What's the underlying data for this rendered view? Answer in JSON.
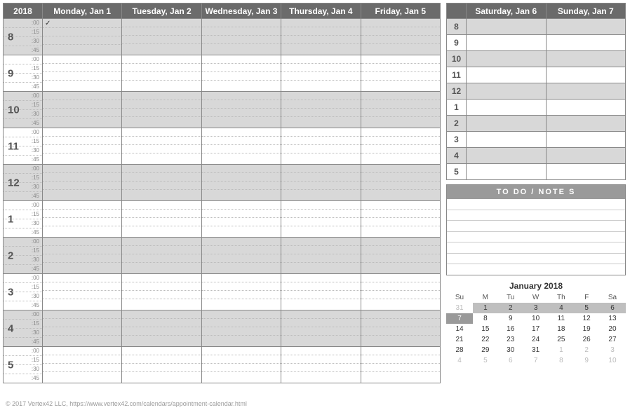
{
  "year": "2018",
  "weekdays": [
    "Monday, Jan 1",
    "Tuesday, Jan 2",
    "Wednesday, Jan 3",
    "Thursday, Jan 4",
    "Friday, Jan 5"
  ],
  "weekend": [
    "Saturday, Jan 6",
    "Sunday, Jan 7"
  ],
  "hours": [
    "8",
    "9",
    "10",
    "11",
    "12",
    "1",
    "2",
    "3",
    "4",
    "5"
  ],
  "subdivisions": [
    ":00",
    ":15",
    ":30",
    ":45"
  ],
  "weekend_hours": [
    "8",
    "9",
    "10",
    "11",
    "12",
    "1",
    "2",
    "3",
    "4",
    "5"
  ],
  "checkmark": "✓",
  "todo_header": "TO DO  /  NOTE S",
  "mini": {
    "title": "January 2018",
    "dow": [
      "Su",
      "M",
      "Tu",
      "W",
      "Th",
      "F",
      "Sa"
    ],
    "rows": [
      [
        {
          "d": "31",
          "cls": "prev"
        },
        {
          "d": "1",
          "cls": "hl"
        },
        {
          "d": "2",
          "cls": "hl"
        },
        {
          "d": "3",
          "cls": "hl"
        },
        {
          "d": "4",
          "cls": "hl"
        },
        {
          "d": "5",
          "cls": "hl"
        },
        {
          "d": "6",
          "cls": "hl"
        }
      ],
      [
        {
          "d": "7",
          "cls": "hl-dark"
        },
        {
          "d": "8",
          "cls": ""
        },
        {
          "d": "9",
          "cls": ""
        },
        {
          "d": "10",
          "cls": ""
        },
        {
          "d": "11",
          "cls": ""
        },
        {
          "d": "12",
          "cls": ""
        },
        {
          "d": "13",
          "cls": ""
        }
      ],
      [
        {
          "d": "14",
          "cls": ""
        },
        {
          "d": "15",
          "cls": ""
        },
        {
          "d": "16",
          "cls": ""
        },
        {
          "d": "17",
          "cls": ""
        },
        {
          "d": "18",
          "cls": ""
        },
        {
          "d": "19",
          "cls": ""
        },
        {
          "d": "20",
          "cls": ""
        }
      ],
      [
        {
          "d": "21",
          "cls": ""
        },
        {
          "d": "22",
          "cls": ""
        },
        {
          "d": "23",
          "cls": ""
        },
        {
          "d": "24",
          "cls": ""
        },
        {
          "d": "25",
          "cls": ""
        },
        {
          "d": "26",
          "cls": ""
        },
        {
          "d": "27",
          "cls": ""
        }
      ],
      [
        {
          "d": "28",
          "cls": ""
        },
        {
          "d": "29",
          "cls": ""
        },
        {
          "d": "30",
          "cls": ""
        },
        {
          "d": "31",
          "cls": ""
        },
        {
          "d": "1",
          "cls": "next"
        },
        {
          "d": "2",
          "cls": "next"
        },
        {
          "d": "3",
          "cls": "next"
        }
      ],
      [
        {
          "d": "4",
          "cls": "next"
        },
        {
          "d": "5",
          "cls": "next"
        },
        {
          "d": "6",
          "cls": "next"
        },
        {
          "d": "7",
          "cls": "next"
        },
        {
          "d": "8",
          "cls": "next"
        },
        {
          "d": "9",
          "cls": "next"
        },
        {
          "d": "10",
          "cls": "next"
        }
      ]
    ]
  },
  "footer": "© 2017 Vertex42 LLC, https://www.vertex42.com/calendars/appointment-calendar.html"
}
